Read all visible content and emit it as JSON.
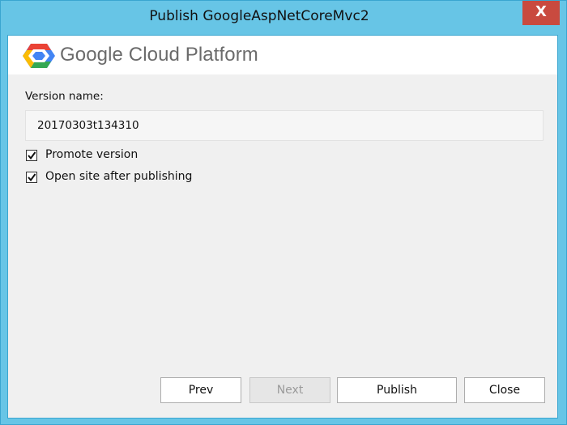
{
  "window": {
    "title": "Publish GoogleAspNetCoreMvc2",
    "close_glyph": "X"
  },
  "banner": {
    "brand": "Google Cloud Platform",
    "logo_icon": "google-cloud-hexagon-icon"
  },
  "form": {
    "version_label": "Version name:",
    "version_value": "20170303t134310",
    "options": [
      {
        "label": "Promote version",
        "checked": true
      },
      {
        "label": "Open site after publishing",
        "checked": true
      }
    ]
  },
  "buttons": {
    "prev": "Prev",
    "next": "Next",
    "publish": "Publish",
    "close": "Close"
  },
  "colors": {
    "frame": "#67c5e6",
    "close_button": "#c94a3f",
    "background": "#f0f0f0"
  }
}
